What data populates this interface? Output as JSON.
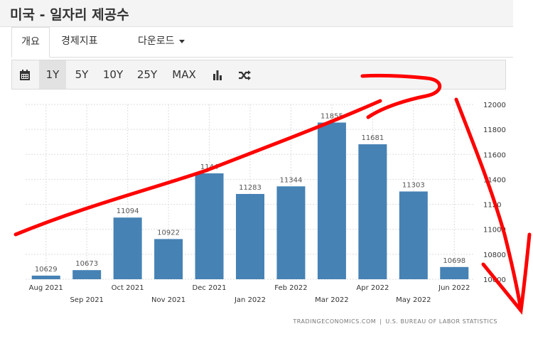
{
  "header": {
    "title": "미국 - 일자리 제공수"
  },
  "tabs": [
    {
      "label": "개요"
    },
    {
      "label": "경제지표"
    },
    {
      "label": "다운로드"
    }
  ],
  "toolbar": {
    "ranges": [
      "1Y",
      "5Y",
      "10Y",
      "25Y",
      "MAX"
    ],
    "active_range": "1Y",
    "icons": [
      "calendar-icon",
      "bar-chart-icon",
      "shuffle-icon"
    ]
  },
  "chart_data": {
    "type": "bar",
    "categories": [
      "Aug 2021",
      "Sep 2021",
      "Oct 2021",
      "Nov 2021",
      "Dec 2021",
      "Jan 2022",
      "Feb 2022",
      "Mar 2022",
      "Apr 2022",
      "May 2022",
      "Jun 2022"
    ],
    "values": [
      10629,
      10673,
      11094,
      10922,
      11448,
      11283,
      11344,
      11855,
      11681,
      11303,
      10698
    ],
    "data_labels": [
      "10629",
      "10673",
      "11094",
      "10922",
      "1144",
      "11283",
      "11344",
      "11855",
      "11681",
      "11303",
      "10698"
    ],
    "ylim": [
      10600,
      12000
    ],
    "yticks": [
      "10600",
      "10800",
      "11000",
      "1120",
      "11400",
      "11600",
      "11800",
      "12000"
    ],
    "ytick_values": [
      10600,
      10800,
      11000,
      11200,
      11400,
      11600,
      11800,
      12000
    ],
    "grid": true,
    "bar_color": "#4682b4",
    "xlabel": "",
    "ylabel": ""
  },
  "source": {
    "left": "TRADINGECONOMICS.COM",
    "separator": "|",
    "right": "U.S. BUREAU OF LABOR STATISTICS"
  },
  "annotation_color": "#ff0000"
}
